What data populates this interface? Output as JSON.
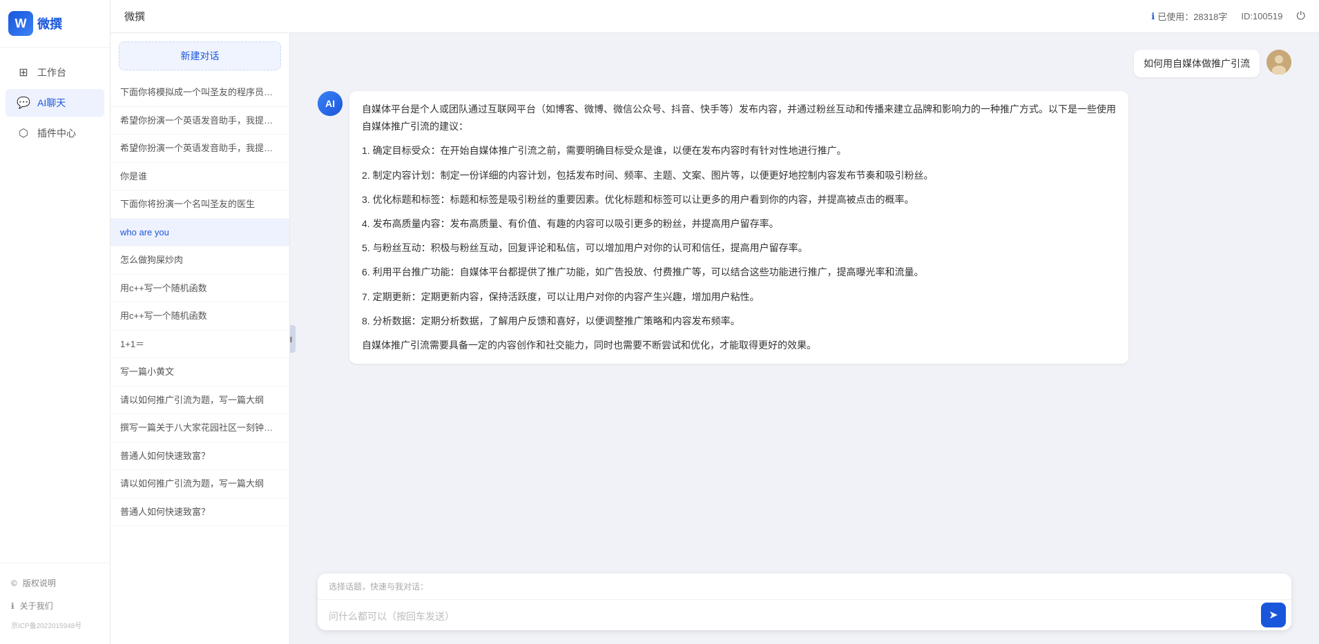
{
  "app": {
    "title": "微撰",
    "logo_letter": "W",
    "logo_text": "微撰"
  },
  "topbar": {
    "title": "微撰",
    "usage_label": "已使用：28318字",
    "id_label": "ID:100519",
    "usage_icon": "ℹ"
  },
  "nav": {
    "items": [
      {
        "id": "workbench",
        "label": "工作台",
        "icon": "⊞"
      },
      {
        "id": "ai-chat",
        "label": "AI聊天",
        "icon": "💬",
        "active": true
      },
      {
        "id": "plugin-center",
        "label": "插件中心",
        "icon": "⬡"
      }
    ],
    "footer_items": [
      {
        "id": "copyright",
        "label": "版权说明",
        "icon": "©"
      },
      {
        "id": "about",
        "label": "关于我们",
        "icon": "ℹ"
      }
    ],
    "icp": "京ICP备2022015948号"
  },
  "chat_list": {
    "new_chat_label": "新建对话",
    "items": [
      {
        "id": 1,
        "text": "下面你将模拟成一个叫圣友的程序员，我说..."
      },
      {
        "id": 2,
        "text": "希望你扮演一个英语发音助手，我提供给你..."
      },
      {
        "id": 3,
        "text": "希望你扮演一个英语发音助手，我提供给你..."
      },
      {
        "id": 4,
        "text": "你是谁"
      },
      {
        "id": 5,
        "text": "下面你将扮演一个名叫圣友的医生"
      },
      {
        "id": 6,
        "text": "who are you",
        "active": true
      },
      {
        "id": 7,
        "text": "怎么做狗屎炒肉"
      },
      {
        "id": 8,
        "text": "用c++写一个随机函数"
      },
      {
        "id": 9,
        "text": "用c++写一个随机函数"
      },
      {
        "id": 10,
        "text": "1+1＝"
      },
      {
        "id": 11,
        "text": "写一篇小黄文"
      },
      {
        "id": 12,
        "text": "请以如何推广引流为题，写一篇大纲"
      },
      {
        "id": 13,
        "text": "撰写一篇关于八大家花园社区一刻钟便民生..."
      },
      {
        "id": 14,
        "text": "普通人如何快速致富？"
      },
      {
        "id": 15,
        "text": "请以如何推广引流为题，写一篇大纲"
      },
      {
        "id": 16,
        "text": "普通人如何快速致富？"
      }
    ]
  },
  "chat": {
    "user_message": "如何用自媒体做推广引流",
    "ai_response": {
      "paragraphs": [
        "自媒体平台是个人或团队通过互联网平台（如博客、微博、微信公众号、抖音、快手等）发布内容，并通过粉丝互动和传播来建立品牌和影响力的一种推广方式。以下是一些使用自媒体推广引流的建议：",
        "1. 确定目标受众：在开始自媒体推广引流之前，需要明确目标受众是谁，以便在发布内容时有针对性地进行推广。",
        "2. 制定内容计划：制定一份详细的内容计划，包括发布时间、频率、主题、文案、图片等，以便更好地控制内容发布节奏和吸引粉丝。",
        "3. 优化标题和标签：标题和标签是吸引粉丝的重要因素。优化标题和标签可以让更多的用户看到你的内容，并提高被点击的概率。",
        "4. 发布高质量内容：发布高质量、有价值、有趣的内容可以吸引更多的粉丝，并提高用户留存率。",
        "5. 与粉丝互动：积极与粉丝互动，回复评论和私信，可以增加用户对你的认可和信任，提高用户留存率。",
        "6. 利用平台推广功能：自媒体平台都提供了推广功能，如广告投放、付费推广等，可以结合这些功能进行推广，提高曝光率和流量。",
        "7. 定期更新：定期更新内容，保持活跃度，可以让用户对你的内容产生兴趣，增加用户粘性。",
        "8. 分析数据：定期分析数据，了解用户反馈和喜好，以便调整推广策略和内容发布频率。",
        "自媒体推广引流需要具备一定的内容创作和社交能力，同时也需要不断尝试和优化，才能取得更好的效果。"
      ]
    }
  },
  "input": {
    "quick_select_label": "选择话题，快速与我对话：",
    "placeholder": "问什么都可以（按回车发送）",
    "send_icon": "➤"
  }
}
